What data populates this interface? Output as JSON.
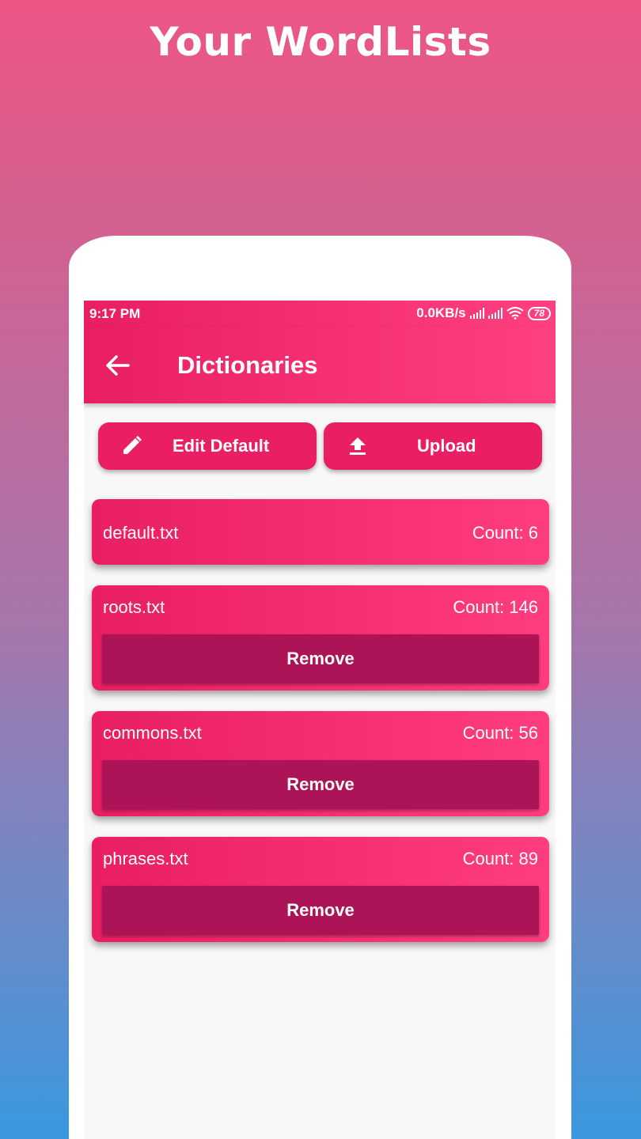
{
  "promo": {
    "title": "Your WordLists"
  },
  "status_bar": {
    "time": "9:17 PM",
    "net_speed": "0.0KB/s",
    "battery": "78"
  },
  "app_bar": {
    "title": "Dictionaries",
    "back_icon": "arrow-left-icon"
  },
  "actions": {
    "edit_default": {
      "label": "Edit Default",
      "icon": "pencil-icon"
    },
    "upload": {
      "label": "Upload",
      "icon": "upload-icon"
    }
  },
  "dictionaries": [
    {
      "name": "default.txt",
      "count": "Count: 6"
    },
    {
      "name": "roots.txt",
      "count": "Count: 146",
      "remove_label": "Remove"
    },
    {
      "name": "commons.txt",
      "count": "Count: 56",
      "remove_label": "Remove"
    },
    {
      "name": "phrases.txt",
      "count": "Count: 89",
      "remove_label": "Remove"
    }
  ],
  "colors": {
    "primary": "#e91e63",
    "primary_light": "#ff4081",
    "remove_button": "#ad1457",
    "screen_bg": "#f8f8f8"
  }
}
